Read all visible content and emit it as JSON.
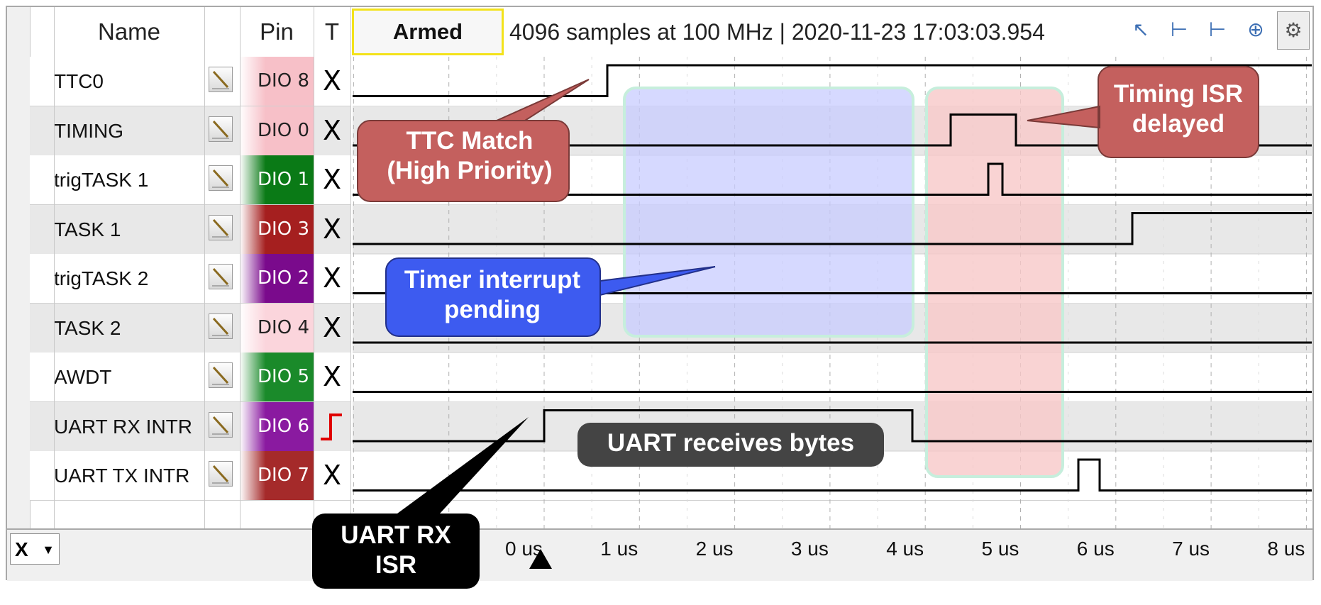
{
  "header": {
    "name_label": "Name",
    "pin_label": "Pin",
    "trigger_label": "T",
    "status_button": "Armed",
    "capture_info": "4096 samples at 100 MHz | 2020-11-23 17:03:03.954"
  },
  "toolbar": {
    "icons": [
      "cursor-icon",
      "marker-a-icon",
      "marker-b-icon",
      "zoom-icon",
      "settings-icon"
    ]
  },
  "channels": [
    {
      "name": "TTC0",
      "pin": "DIO  8",
      "pin_color": "#f7c0c8",
      "pin_text": "#222222",
      "trigger": "X"
    },
    {
      "name": "TIMING",
      "pin": "DIO  0",
      "pin_color": "#f7c0c8",
      "pin_text": "#222222",
      "trigger": "X"
    },
    {
      "name": "trigTASK 1",
      "pin": "DIO  1",
      "pin_color": "#0a7a16",
      "pin_text": "#ffffff",
      "trigger": "X"
    },
    {
      "name": "TASK 1",
      "pin": "DIO  3",
      "pin_color": "#a51f1f",
      "pin_text": "#ffffff",
      "trigger": "X"
    },
    {
      "name": "trigTASK 2",
      "pin": "DIO  2",
      "pin_color": "#7a0a8c",
      "pin_text": "#ffffff",
      "trigger": "X"
    },
    {
      "name": "TASK 2",
      "pin": "DIO  4",
      "pin_color": "#fbd5dc",
      "pin_text": "#222222",
      "trigger": "X"
    },
    {
      "name": "AWDT",
      "pin": "DIO  5",
      "pin_color": "#1a8a2a",
      "pin_text": "#ffffff",
      "trigger": "X"
    },
    {
      "name": "UART RX INTR",
      "pin": "DIO  6",
      "pin_color": "#8a1aa0",
      "pin_text": "#ffffff",
      "trigger": "rising-edge-icon"
    },
    {
      "name": "UART TX INTR",
      "pin": "DIO  7",
      "pin_color": "#a52a2a",
      "pin_text": "#ffffff",
      "trigger": "X"
    }
  ],
  "timeline": {
    "axis_selector": "X",
    "ticks": [
      "0 us",
      "1 us",
      "2 us",
      "3 us",
      "4 us",
      "5 us",
      "6 us",
      "7 us",
      "8 us"
    ],
    "trigger_marker": "0 us"
  },
  "annotations": {
    "ttc_match": "TTC Match\n(High Priority)",
    "timing_isr": "Timing ISR\ndelayed",
    "timer_pending": "Timer interrupt\npending",
    "uart_receives": "UART receives bytes",
    "uart_rx_isr": "UART RX\nISR"
  },
  "colors": {
    "blue_region": "#c8ccff",
    "red_region": "#f8c8c8",
    "callout_red": "#c4605e",
    "callout_blue": "#3d5bf0",
    "callout_dark": "#444444",
    "callout_black": "#000000"
  }
}
